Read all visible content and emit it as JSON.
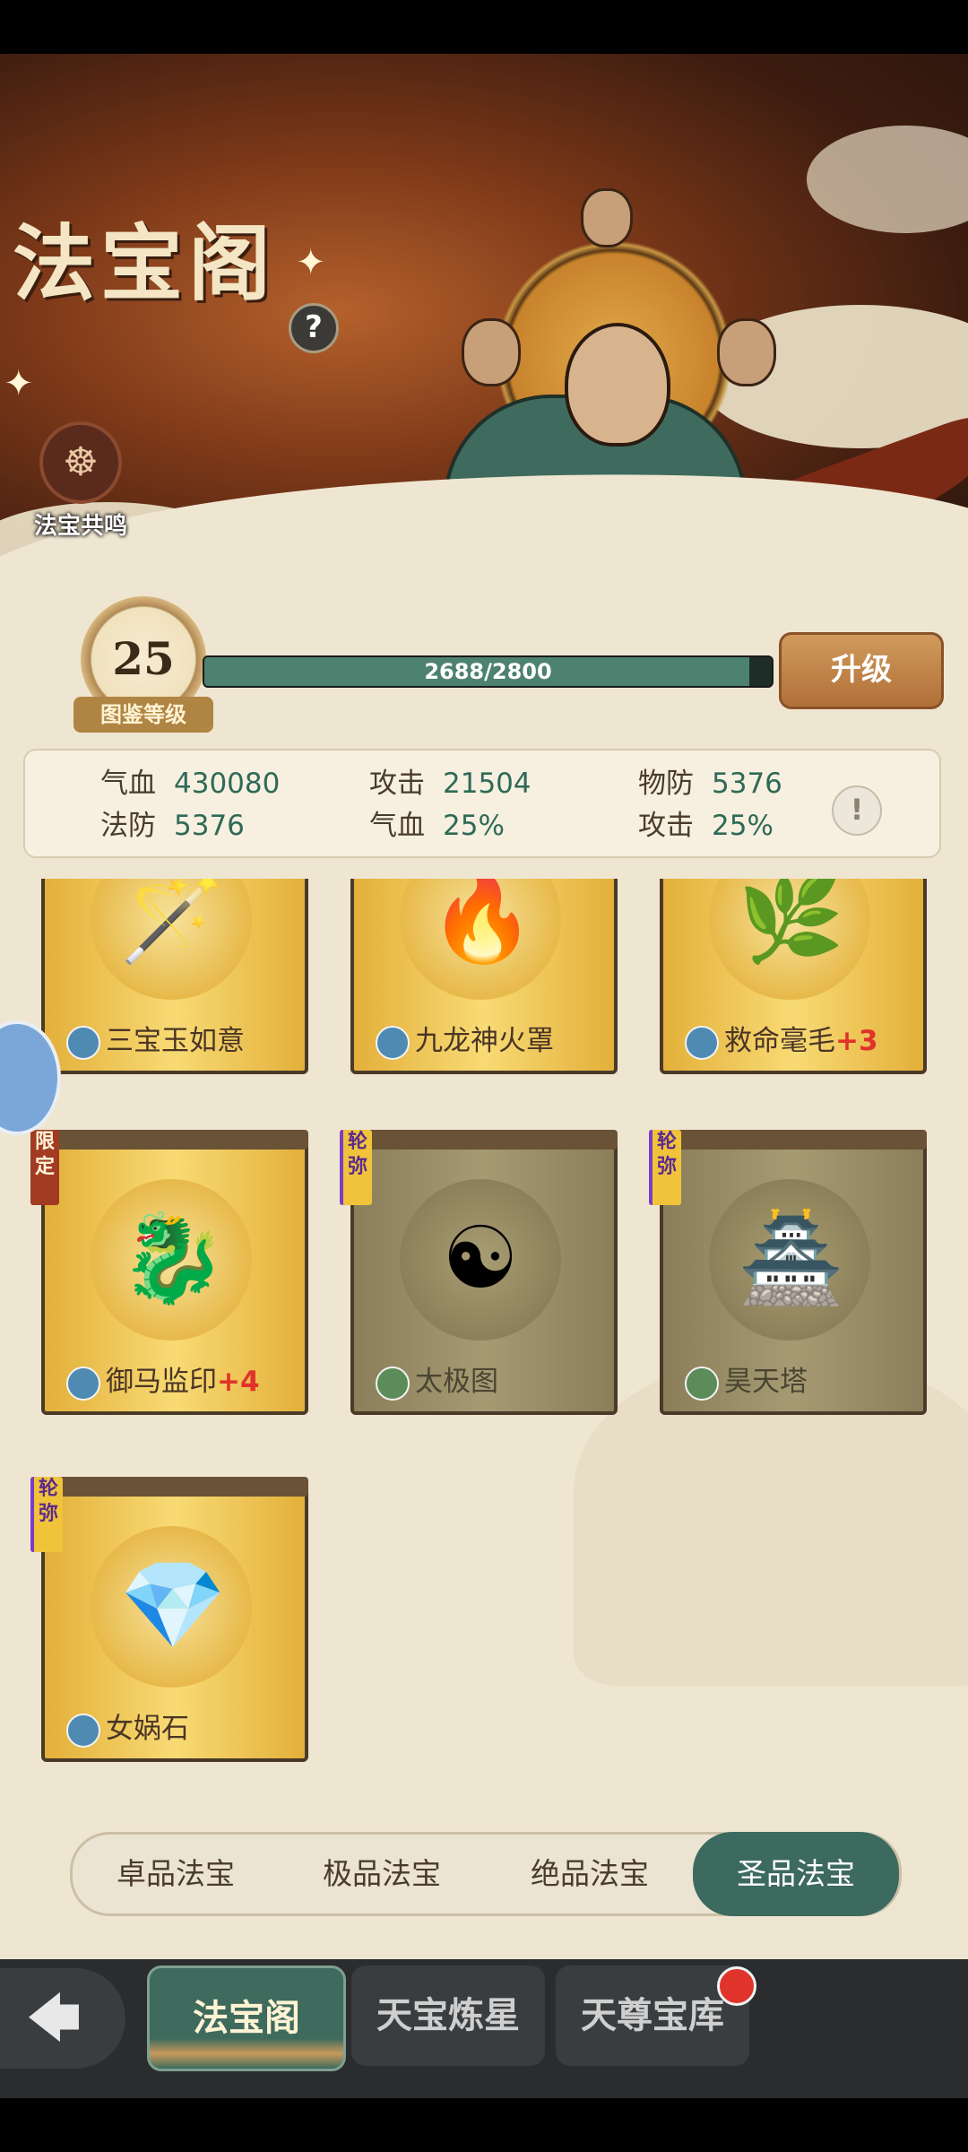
{
  "header": {
    "title": "法宝阁",
    "help_icon": "?",
    "resonance_label": "法宝共鸣"
  },
  "level": {
    "value": "25",
    "caption": "图鉴等级",
    "xp_text": "2688/2800",
    "xp_fraction": 0.96,
    "upgrade_label": "升级"
  },
  "stats": [
    {
      "label": "气血",
      "value": "430080"
    },
    {
      "label": "攻击",
      "value": "21504"
    },
    {
      "label": "物防",
      "value": "5376"
    },
    {
      "label": "法防",
      "value": "5376"
    },
    {
      "label": "气血",
      "value": "25%"
    },
    {
      "label": "攻击",
      "value": "25%"
    }
  ],
  "info_icon": "!",
  "cards": [
    {
      "name": "三宝玉如意",
      "plus": "",
      "icon": "ruyi-icon",
      "glyph": "🪄",
      "style": "gold",
      "tag": ""
    },
    {
      "name": "九龙神火罩",
      "plus": "",
      "icon": "fire-cover-icon",
      "glyph": "🔥",
      "style": "gold",
      "tag": ""
    },
    {
      "name": "救命毫毛",
      "plus": "+3",
      "icon": "hair-icon",
      "glyph": "🌿",
      "style": "gold",
      "tag": ""
    },
    {
      "name": "御马监印",
      "plus": "+4",
      "icon": "seal-icon",
      "glyph": "🐉",
      "style": "gold",
      "tag": "限定"
    },
    {
      "name": "太极图",
      "plus": "",
      "icon": "taiji-icon",
      "glyph": "☯",
      "style": "grey",
      "tag": "轮弥"
    },
    {
      "name": "昊天塔",
      "plus": "",
      "icon": "pagoda-icon",
      "glyph": "🏯",
      "style": "grey",
      "tag": "轮弥"
    },
    {
      "name": "女娲石",
      "plus": "",
      "icon": "crystal-icon",
      "glyph": "💎",
      "style": "gold",
      "tag": "轮弥"
    }
  ],
  "tabs": [
    "卓品法宝",
    "极品法宝",
    "绝品法宝",
    "圣品法宝"
  ],
  "active_tab": 3,
  "nav": {
    "back_icon": "🡄",
    "items": [
      "法宝阁",
      "天宝炼星",
      "天尊宝库"
    ],
    "active": 0
  }
}
